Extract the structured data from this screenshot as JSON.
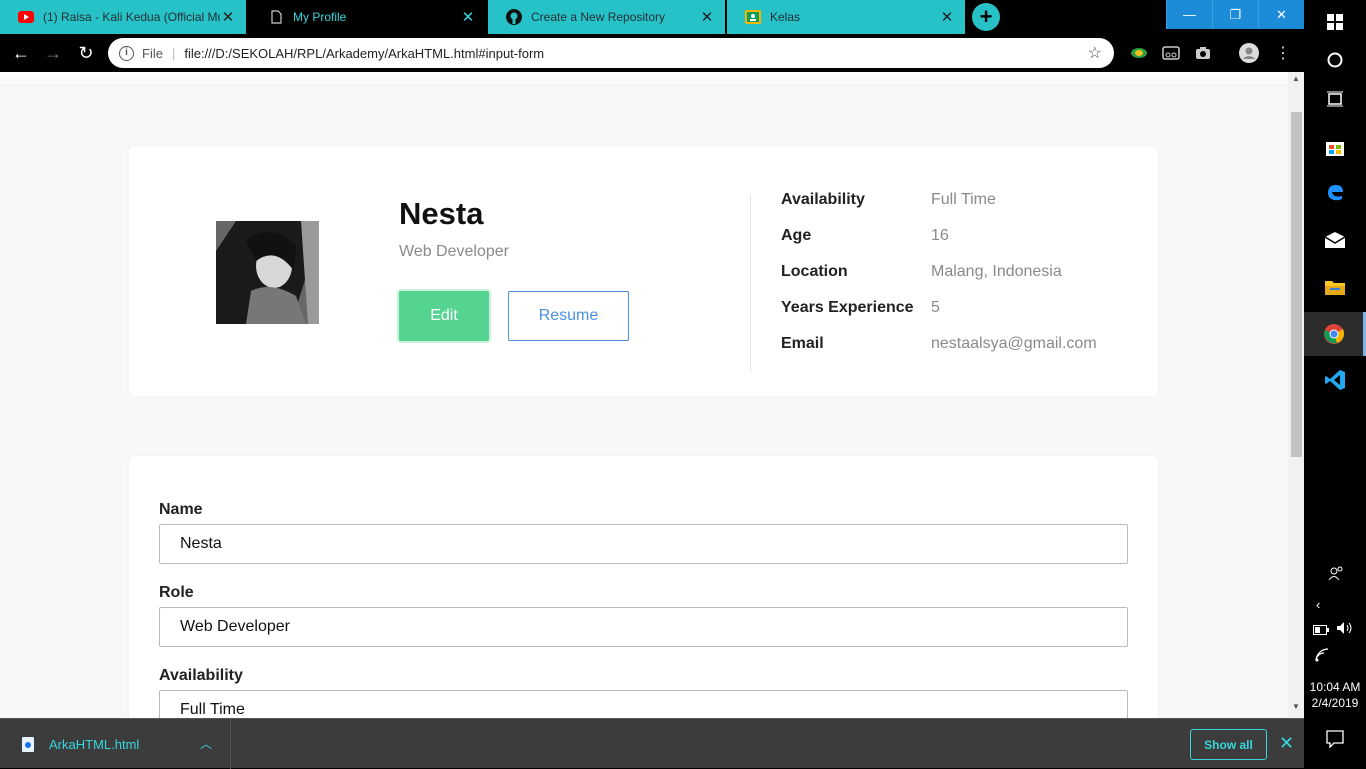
{
  "browser": {
    "tabs": [
      {
        "title": "(1) Raisa - Kali Kedua (Official Mu",
        "icon": "youtube-icon",
        "active": false
      },
      {
        "title": "My Profile",
        "icon": "document-icon",
        "active": true
      },
      {
        "title": "Create a New Repository",
        "icon": "github-icon",
        "active": false
      },
      {
        "title": "Kelas",
        "icon": "classroom-icon",
        "active": false
      }
    ],
    "new_tab": "+",
    "window_controls": {
      "minimize": "—",
      "restore": "❐",
      "close": "✕"
    },
    "nav": {
      "back": "←",
      "forward": "→",
      "reload": "↻"
    },
    "address": {
      "scheme_label": "File",
      "url": "file:///D:/SEKOLAH/RPL/Arkademy/ArkaHTML.html#input-form"
    },
    "menu_glyph": "⋮"
  },
  "profile": {
    "name": "Nesta",
    "role": "Web Developer",
    "edit_label": "Edit",
    "resume_label": "Resume",
    "details": [
      {
        "label": "Availability",
        "value": "Full Time"
      },
      {
        "label": "Age",
        "value": "16"
      },
      {
        "label": "Location",
        "value": "Malang, Indonesia"
      },
      {
        "label": "Years Experience",
        "value": "5"
      },
      {
        "label": "Email",
        "value": "nestaalsya@gmail.com"
      }
    ]
  },
  "form": {
    "fields": [
      {
        "label": "Name",
        "value": "Nesta"
      },
      {
        "label": "Role",
        "value": "Web Developer"
      },
      {
        "label": "Availability",
        "value": "Full Time"
      }
    ]
  },
  "downloads": {
    "file_name": "ArkaHTML.html",
    "show_all_label": "Show all"
  },
  "taskbar": {
    "time": "10:04 AM",
    "date": "2/4/2019"
  },
  "colors": {
    "accent_tab": "#27c1c8",
    "edit_button": "#55d491",
    "resume_button": "#4a90e2"
  }
}
